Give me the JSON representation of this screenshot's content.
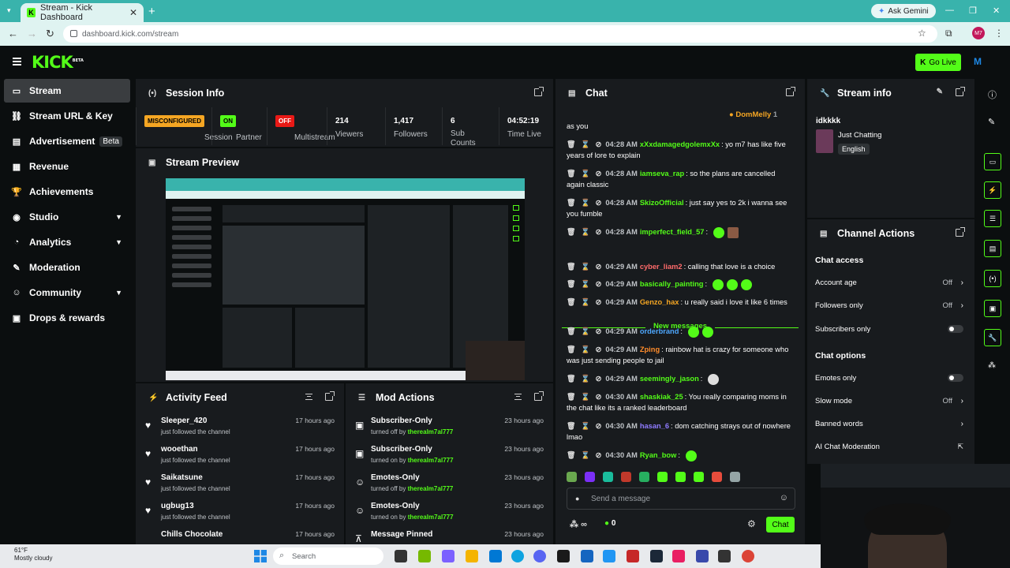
{
  "browser": {
    "tab_title": "Stream - Kick Dashboard",
    "url": "dashboard.kick.com/stream",
    "gemini_label": "Ask Gemini",
    "profile_initials": "M7"
  },
  "header": {
    "logo": "KICK",
    "logo_tag": "BETA",
    "go_live_label": "Go Live"
  },
  "sidebar": {
    "items": [
      {
        "label": "Stream",
        "icon": "stream-icon"
      },
      {
        "label": "Stream URL & Key",
        "icon": "link-icon"
      },
      {
        "label": "Advertisement",
        "icon": "ad-icon",
        "badge": "Beta"
      },
      {
        "label": "Revenue",
        "icon": "revenue-icon"
      },
      {
        "label": "Achievements",
        "icon": "trophy-icon"
      },
      {
        "label": "Studio",
        "icon": "studio-icon"
      },
      {
        "label": "Analytics",
        "icon": "analytics-icon"
      },
      {
        "label": "Moderation",
        "icon": "moderation-icon"
      },
      {
        "label": "Community",
        "icon": "community-icon"
      },
      {
        "label": "Drops & rewards",
        "icon": "gift-icon"
      }
    ]
  },
  "session": {
    "title": "Session Info",
    "session_status": "MISCONFIGURED",
    "session_label": "Session",
    "partner_status": "ON",
    "partner_label": "Partner",
    "multistream_status": "OFF",
    "multistream_label": "Multistream",
    "viewers": "214",
    "viewers_label": "Viewers",
    "followers": "1,417",
    "followers_label": "Followers",
    "subs": "6",
    "subs_label": "Sub Counts",
    "time_live": "04:52:19",
    "time_live_label": "Time Live"
  },
  "preview": {
    "title": "Stream Preview"
  },
  "activity": {
    "title": "Activity Feed",
    "items": [
      {
        "name": "Sleeper_420",
        "sub": "just followed the channel",
        "time": "17 hours ago"
      },
      {
        "name": "wooethan",
        "sub": "just followed the channel",
        "time": "17 hours ago"
      },
      {
        "name": "Saikatsune",
        "sub": "just followed the channel",
        "time": "17 hours ago"
      },
      {
        "name": "ugbug13",
        "sub": "just followed the channel",
        "time": "17 hours ago"
      },
      {
        "name": "Chills Chocolate",
        "sub": "",
        "time": "17 hours ago"
      }
    ]
  },
  "mod": {
    "title": "Mod Actions",
    "items": [
      {
        "name": "Subscriber-Only",
        "sub": "turned off by",
        "by": "therealm7al777",
        "time": "23 hours ago"
      },
      {
        "name": "Subscriber-Only",
        "sub": "turned on by",
        "by": "therealm7al777",
        "time": "23 hours ago"
      },
      {
        "name": "Emotes-Only",
        "sub": "turned off by",
        "by": "therealm7al777",
        "time": "23 hours ago"
      },
      {
        "name": "Emotes-Only",
        "sub": "turned on by",
        "by": "therealm7al777",
        "time": "23 hours ago"
      },
      {
        "name": "Message Pinned",
        "sub": "",
        "by": "",
        "time": "23 hours ago"
      }
    ]
  },
  "chat": {
    "title": "Chat",
    "pinned_user": "DomMelly",
    "pinned_count": "1",
    "top_text": "as you",
    "new_messages_label": "New messages",
    "messages": [
      {
        "time": "04:28 AM",
        "user": "xXxdamagedgolemxXx",
        "color": "#53fc18",
        "text": "yo m7 has like five years of lore to explain"
      },
      {
        "time": "04:28 AM",
        "user": "iamseva_rap",
        "color": "#53fc18",
        "text": "so the plans are cancelled again classic"
      },
      {
        "time": "04:28 AM",
        "user": "SkizoOfficial",
        "color": "#53fc18",
        "text": "just say yes to 2k i wanna see you fumble"
      },
      {
        "time": "04:28 AM",
        "user": "imperfect_field_57",
        "color": "#53fc18",
        "text": ""
      },
      {
        "time": "04:29 AM",
        "user": "cyber_liam2",
        "color": "#ff6b6b",
        "text": "calling that love is a choice"
      },
      {
        "time": "04:29 AM",
        "user": "basically_painting",
        "color": "#53fc18",
        "text": ""
      },
      {
        "time": "04:29 AM",
        "user": "Genzo_hax",
        "color": "#f5a623",
        "text": "u really said i love it like 6 times"
      },
      {
        "time": "04:29 AM",
        "user": "orderbrand",
        "color": "#4ea8ff",
        "text": ""
      },
      {
        "time": "04:29 AM",
        "user": "Zping",
        "color": "#ff8c2b",
        "text": "rainbow hat is crazy for someone who was just sending people to jail"
      },
      {
        "time": "04:29 AM",
        "user": "seemingly_jason",
        "color": "#53fc18",
        "text": ""
      },
      {
        "time": "04:30 AM",
        "user": "shaskiak_25",
        "color": "#53fc18",
        "text": "You really comparing moms in the chat like its a ranked leaderboard"
      },
      {
        "time": "04:30 AM",
        "user": "hasan_6",
        "color": "#8f7bff",
        "text": "dom catching strays out of nowhere lmao"
      },
      {
        "time": "04:30 AM",
        "user": "Ryan_bow",
        "color": "#53fc18",
        "text": ""
      }
    ],
    "input_placeholder": "Send a message",
    "infinity_label": "∞",
    "kick_count": "0",
    "send_label": "Chat"
  },
  "stream_info": {
    "title": "Stream info",
    "stream_title": "idkkkk",
    "category": "Just Chatting",
    "language": "English"
  },
  "channel_actions": {
    "title": "Channel Actions",
    "chat_access_label": "Chat access",
    "account_age_label": "Account age",
    "account_age_value": "Off",
    "followers_only_label": "Followers only",
    "followers_only_value": "Off",
    "subscribers_only_label": "Subscribers only",
    "chat_options_label": "Chat options",
    "emotes_only_label": "Emotes only",
    "slow_mode_label": "Slow mode",
    "slow_mode_value": "Off",
    "banned_words_label": "Banned words",
    "ai_moderation_label": "AI Chat Moderation"
  },
  "taskbar": {
    "temperature": "61°F",
    "weather": "Mostly cloudy",
    "search_placeholder": "Search"
  }
}
